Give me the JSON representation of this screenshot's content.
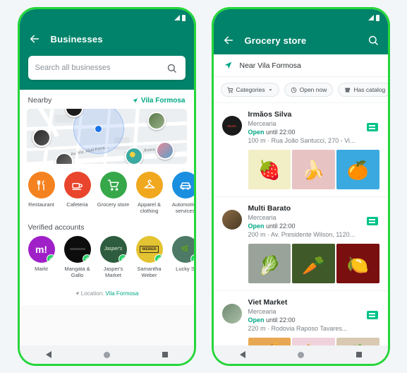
{
  "theme": {
    "header_green": "#00836a",
    "accent_green": "#00a884",
    "frame_green": "#25d63a",
    "badge_green": "#00c389"
  },
  "left_phone": {
    "statusbar": {
      "signal_icon": "signal-icon",
      "battery_icon": "battery-icon"
    },
    "appbar": {
      "back_icon": "back-arrow-icon",
      "title": "Businesses"
    },
    "search": {
      "placeholder": "Search all businesses",
      "icon": "search-icon"
    },
    "nearby": {
      "label": "Nearby",
      "location": "Vila Formosa",
      "location_icon": "navigation-arrow-icon",
      "map": {
        "street_labels": [
          "Av. Vor. Abel Ferre...",
          "Ver. Abe...ffreira"
        ],
        "user_dot": "current-location-dot",
        "markers": 6
      }
    },
    "categories": [
      {
        "label": "Restaurant",
        "icon": "cutlery-icon",
        "color": "#f58220",
        "glyph": "🍴"
      },
      {
        "label": "Cafeteria",
        "icon": "cafeteria-icon",
        "color": "#e8452c",
        "glyph": "☕"
      },
      {
        "label": "Grocery store",
        "icon": "shopping-cart-icon",
        "color": "#36a84a",
        "glyph": "🛒"
      },
      {
        "label": "Apparel & clothing",
        "icon": "hanger-icon",
        "color": "#f0a81e",
        "glyph": "👔"
      },
      {
        "label": "Automotive services",
        "icon": "car-icon",
        "color": "#1a8fe0",
        "glyph": "🚗"
      }
    ],
    "verified": {
      "title": "Verified accounts",
      "accounts": [
        {
          "label": "Markt",
          "logo_text": "m!",
          "color": "#a020c8",
          "verified_icon": "verified-check-icon"
        },
        {
          "label": "Mangata & Gallo",
          "logo_text": "",
          "color": "#0d0d0d",
          "verified_icon": "verified-check-icon"
        },
        {
          "label": "Jasper's Market",
          "logo_text": "Jasper's",
          "color": "#2e5c3e",
          "verified_icon": "verified-check-icon"
        },
        {
          "label": "Samantha Weber",
          "logo_text": "WEBER",
          "color": "#e3c331",
          "verified_icon": "verified-check-icon"
        },
        {
          "label": "Lucky S",
          "logo_text": "",
          "color": "#4c7a66",
          "verified_icon": "verified-check-icon"
        }
      ]
    },
    "footer": {
      "prefix": "Location:",
      "link": "Vila Formosa",
      "icon": "navigation-arrow-icon"
    },
    "navbar": {
      "back": "nav-back-icon",
      "home": "nav-home-icon",
      "recents": "nav-recents-icon"
    }
  },
  "right_phone": {
    "statusbar": {
      "signal_icon": "signal-icon",
      "battery_icon": "battery-icon"
    },
    "appbar": {
      "back_icon": "back-arrow-icon",
      "title": "Grocery store",
      "search_icon": "search-icon"
    },
    "near": {
      "icon": "navigation-arrow-icon",
      "text": "Near Vila Formosa"
    },
    "filters": [
      {
        "label": "Categories",
        "icon": "shopping-cart-icon",
        "has_chevron": true
      },
      {
        "label": "Open now",
        "icon": "clock-icon",
        "has_chevron": false
      },
      {
        "label": "Has catalog",
        "icon": "storefront-icon",
        "has_chevron": false
      }
    ],
    "listings": [
      {
        "name": "Irmãos Silva",
        "category": "Mercearia",
        "open_label": "Open",
        "open_rest": "until 22:00",
        "address": "100 m · Rua João Santucci, 270 - Vi...",
        "catalog_badge_icon": "catalog-badge-icon",
        "avatar_text": "SILVA",
        "avatar_color": "#1b1b1b",
        "photos": [
          {
            "name": "strawberry-photo",
            "bg": "#f2efc6",
            "item": "#d9243a"
          },
          {
            "name": "banana-photo",
            "bg": "#e8c3c3",
            "item": "#f0d040"
          },
          {
            "name": "orange-photo",
            "bg": "#3aa9e0",
            "item": "#f08a1c"
          }
        ]
      },
      {
        "name": "Multi Barato",
        "category": "Mercearia",
        "open_label": "Open",
        "open_rest": "until 22:00",
        "address": "200 m · Av. Presidente Wilson, 1120...",
        "catalog_badge_icon": "catalog-badge-icon",
        "avatar_text": "",
        "avatar_color": "#8a6a44",
        "photos": [
          {
            "name": "lettuce-photo",
            "bg": "#9aa39a",
            "item": "#6aa83c"
          },
          {
            "name": "carrots-photo",
            "bg": "#3f5a28",
            "item": "#ef7a12"
          },
          {
            "name": "peppers-photo",
            "bg": "#7a0f10",
            "item": "#cc1418"
          }
        ]
      },
      {
        "name": "Viet Market",
        "category": "Mercearia",
        "open_label": "Open",
        "open_rest": "until 22:00",
        "address": "220 m · Rodovia Raposo Tavares...",
        "catalog_badge_icon": "catalog-badge-icon",
        "avatar_text": "",
        "avatar_color": "#6f8a72",
        "photos": [
          {
            "name": "bread-photo",
            "bg": "#e8a853",
            "item": "#f5d79a"
          },
          {
            "name": "bottles-photo",
            "bg": "#efd2dc",
            "item": "#b0539a"
          },
          {
            "name": "salad-photo",
            "bg": "#d9c9b2",
            "item": "#6aa83c"
          }
        ]
      }
    ],
    "navbar": {
      "back": "nav-back-icon",
      "home": "nav-home-icon",
      "recents": "nav-recents-icon"
    }
  }
}
